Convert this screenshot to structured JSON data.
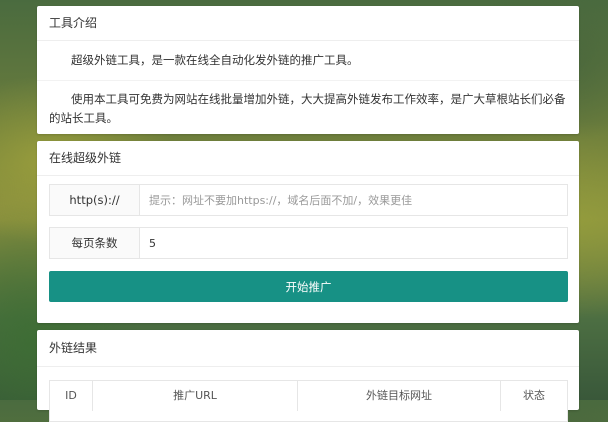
{
  "intro": {
    "title": "工具介绍",
    "paragraph1": "超级外链工具，是一款在线全自动化发外链的推广工具。",
    "paragraph2": "使用本工具可免费为网站在线批量增加外链，大大提高外链发布工作效率，是广大草根站长们必备的站长工具。"
  },
  "form": {
    "title": "在线超级外链",
    "url_label": "http(s)://",
    "url_placeholder": "提示：网址不要加https://，域名后面不加/，效果更佳",
    "per_page_label": "每页条数",
    "per_page_value": "5",
    "submit_label": "开始推广"
  },
  "results": {
    "title": "外链结果",
    "columns": [
      "ID",
      "推广URL",
      "外链目标网址",
      "状态"
    ]
  }
}
